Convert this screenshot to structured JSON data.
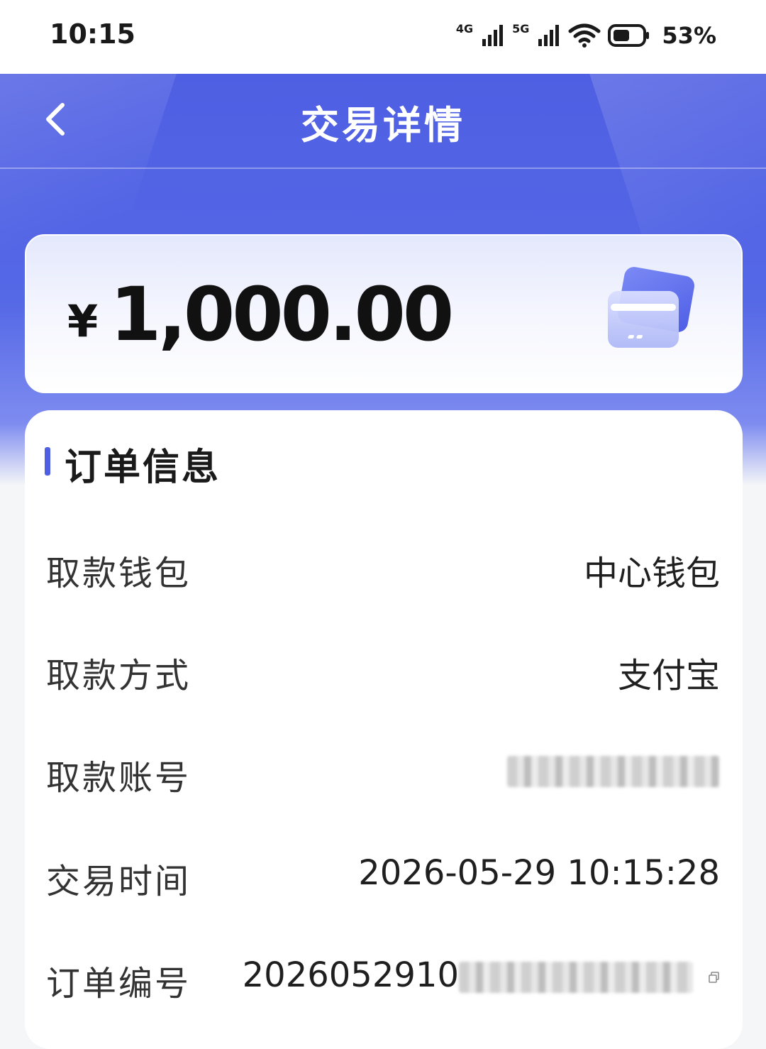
{
  "status_bar": {
    "time": "10:15",
    "net1": "4G",
    "net2": "5G",
    "battery_pct": "53%"
  },
  "nav": {
    "title": "交易详情",
    "back_icon": "chevron-left-icon"
  },
  "amount": {
    "currency": "¥",
    "value": "1,000.00",
    "icon": "wallet-card-icon"
  },
  "order_info": {
    "section_title": "订单信息",
    "rows": [
      {
        "label": "取款钱包",
        "value": "中心钱包"
      },
      {
        "label": "取款方式",
        "value": "支付宝"
      },
      {
        "label": "取款账号",
        "value": ""
      },
      {
        "label": "交易时间",
        "value": "2026-05-29 10:15:28"
      },
      {
        "label": "订单编号",
        "value": "2026052910"
      }
    ]
  },
  "colors": {
    "accent": "#4f5fe3",
    "hero_top": "#4f5fe3",
    "card_bg": "#ffffff",
    "page_bg": "#f5f6f8"
  }
}
